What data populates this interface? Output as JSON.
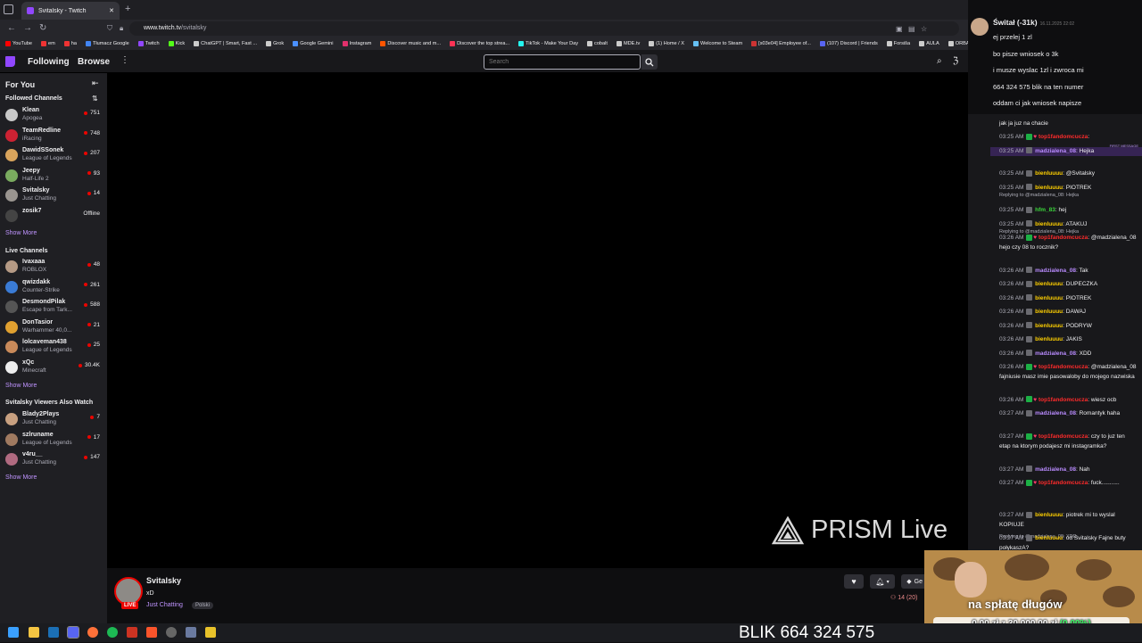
{
  "browser": {
    "tab_title": "Svitalsky - Twitch",
    "new_tab": "+",
    "url_host": "www.twitch.tv",
    "url_path": "/svitalsky",
    "bookmarks": [
      {
        "label": "YouTube",
        "color": "#ff0000"
      },
      {
        "label": "em",
        "color": "#e33"
      },
      {
        "label": "ha",
        "color": "#e33"
      },
      {
        "label": "Tłumacz Google",
        "color": "#4285f4"
      },
      {
        "label": "Twitch",
        "color": "#9147ff"
      },
      {
        "label": "Kick",
        "color": "#53fc18"
      },
      {
        "label": "ChatGPT | Smart, Fast ...",
        "color": "#cccccc"
      },
      {
        "label": "Grok",
        "color": "#cccccc"
      },
      {
        "label": "Google Gemini",
        "color": "#4b90ff"
      },
      {
        "label": "Instagram",
        "color": "#e1306c"
      },
      {
        "label": "Discover music and m...",
        "color": "#ff5500"
      },
      {
        "label": "Discover the top strea...",
        "color": "#f35"
      },
      {
        "label": "TikTok - Make Your Day",
        "color": "#25f4ee"
      },
      {
        "label": "cobalt",
        "color": "#cccccc"
      },
      {
        "label": "MDE.tv",
        "color": "#cccccc"
      },
      {
        "label": "(1) Home / X",
        "color": "#cccccc"
      },
      {
        "label": "Welcome to Steam",
        "color": "#66c0f4"
      },
      {
        "label": "[s03e04] Employee of...",
        "color": "#cc3333"
      },
      {
        "label": "(107) Discord | Friends",
        "color": "#5865f2"
      },
      {
        "label": "Forsiša",
        "color": "#cccccc"
      },
      {
        "label": "AULA",
        "color": "#cccccc"
      },
      {
        "label": "ORBAT",
        "color": "#cccccc"
      }
    ]
  },
  "nav": {
    "following": "Following",
    "browse": "Browse",
    "more": "⋮",
    "search_placeholder": "Search"
  },
  "sidebar": {
    "for_you": "For You",
    "followed_title": "Followed Channels",
    "followed": [
      {
        "name": "Klean",
        "game": "Apogea",
        "viewers": "751",
        "color": "#c8c8c8"
      },
      {
        "name": "TeamRedline",
        "game": "iRacing",
        "viewers": "748",
        "color": "#cc2233"
      },
      {
        "name": "DawidSSonek",
        "game": "League of Legends",
        "viewers": "207",
        "color": "#d9a45c"
      },
      {
        "name": "Jeepy",
        "game": "Half-Life 2",
        "viewers": "93",
        "color": "#7aab5f"
      },
      {
        "name": "Svitalsky",
        "game": "Just Chatting",
        "viewers": "14",
        "color": "#9a9590"
      },
      {
        "name": "zosik7",
        "game": "",
        "viewers": "Offline",
        "color": "#444"
      }
    ],
    "show_more_1": "Show More",
    "live_title": "Live Channels",
    "live": [
      {
        "name": "Ivaxaaa",
        "game": "ROBLOX",
        "viewers": "48",
        "color": "#b59a85"
      },
      {
        "name": "qwizdakk",
        "game": "Counter-Strike",
        "viewers": "261",
        "color": "#3a7bd5"
      },
      {
        "name": "DesmondPilak",
        "game": "Escape from Tark...",
        "viewers": "588",
        "color": "#555"
      },
      {
        "name": "DonTasior",
        "game": "Warhammer 40,0...",
        "viewers": "21",
        "color": "#e0a030"
      },
      {
        "name": "lolcaveman438",
        "game": "League of Legends",
        "viewers": "25",
        "color": "#c98a5a"
      },
      {
        "name": "xQc",
        "game": "Minecraft",
        "viewers": "30.4K",
        "color": "#eee"
      }
    ],
    "show_more_2": "Show More",
    "also_title": "Svitalsky Viewers Also Watch",
    "also": [
      {
        "name": "Blady2Plays",
        "game": "Just Chatting",
        "viewers": "7",
        "color": "#c8a080"
      },
      {
        "name": "szlruname",
        "game": "League of Legends",
        "viewers": "17",
        "color": "#a07a60"
      },
      {
        "name": "v4ru__",
        "game": "Just Chatting",
        "viewers": "147",
        "color": "#b06a80"
      }
    ],
    "show_more_3": "Show More"
  },
  "video": {
    "watermark": "PRISM Live"
  },
  "channel": {
    "name": "Svitalsky",
    "title": "xD",
    "category": "Just Chatting",
    "tag": "Polski",
    "live": "LIVE",
    "viewers": "14 (20)",
    "gift_label": "Ge"
  },
  "overlay": {
    "name": "Świtał (-31k)",
    "time": "16.11.2025 22:02",
    "lines": [
      "ej przelej 1 zl",
      "bo pisze wniosek o 3k",
      "i musze wyslac 1zl i zwroca mi",
      "664 324 575 blik na ten numer",
      "oddam ci jak wniosek napisze"
    ]
  },
  "chat": {
    "partial": "jak ja juz na chacie",
    "messages": [
      {
        "time": "03:25 AM",
        "user": "top1fandomcucza",
        "text": "",
        "color": "#ff2b2b",
        "emote": true
      },
      {
        "time": "03:25 AM",
        "user": "madzialena_08",
        "text": "Hejka",
        "color": "#b98bff",
        "first": "FIRST MESSAGE"
      },
      {
        "reply": "Replying to @madzialena_08: Hejka"
      },
      {
        "time": "03:25 AM",
        "user": "bienluuuu",
        "text": "@Svitalsky",
        "color": "#ffd000"
      },
      {
        "time": "03:25 AM",
        "user": "bienluuuu",
        "text": "PIOTREK",
        "color": "#ffd000"
      },
      {
        "reply": "Replying to @madzialena_08: Hejka"
      },
      {
        "time": "03:25 AM",
        "user": "hfm_83",
        "text": "hej",
        "color": "#3bd63b"
      },
      {
        "time": "03:25 AM",
        "user": "bienluuuu",
        "text": "ATAKUJ",
        "color": "#ffd000"
      },
      {
        "time": "03:26 AM",
        "user": "top1fandomcucza",
        "text": "@madzialena_08 hejo czy 08 to rocznik?",
        "color": "#ff2b2b"
      },
      {
        "time": "03:26 AM",
        "user": "madzialena_08",
        "text": "Tak",
        "color": "#b98bff"
      },
      {
        "time": "03:26 AM",
        "user": "bienluuuu",
        "text": "DUPECZKA",
        "color": "#ffd000"
      },
      {
        "time": "03:26 AM",
        "user": "bienluuuu",
        "text": "PIOTREK",
        "color": "#ffd000"
      },
      {
        "time": "03:26 AM",
        "user": "bienluuuu",
        "text": "DAWAJ",
        "color": "#ffd000"
      },
      {
        "time": "03:26 AM",
        "user": "bienluuuu",
        "text": "PODRYW",
        "color": "#ffd000"
      },
      {
        "time": "03:26 AM",
        "user": "bienluuuu",
        "text": "JAKIS",
        "color": "#ffd000"
      },
      {
        "time": "03:26 AM",
        "user": "madzialena_08",
        "text": "XDD",
        "color": "#b98bff"
      },
      {
        "time": "03:26 AM",
        "user": "top1fandomcucza",
        "text": "@madzialena_08 fajniusie masz imie pasowaloby do mojego nazwiska",
        "color": "#ff2b2b"
      },
      {
        "time": "03:26 AM",
        "user": "top1fandomcucza",
        "text": "wiesz ocb",
        "color": "#ff2b2b"
      },
      {
        "time": "03:27 AM",
        "user": "madzialena_08",
        "text": "Romantyk haha",
        "color": "#b98bff"
      },
      {
        "time": "03:27 AM",
        "user": "top1fandomcucza",
        "text": "czy to juz ten etap na ktorym podajesz mi instagramka?",
        "color": "#ff2b2b"
      },
      {
        "time": "03:27 AM",
        "user": "madzialena_08",
        "text": "Nah",
        "color": "#b98bff"
      },
      {
        "time": "03:27 AM",
        "user": "top1fandomcucza",
        "text": "fuck...........",
        "color": "#ff2b2b"
      },
      {
        "reply": "Replying to @madzialena_08: XDD"
      },
      {
        "time": "03:27 AM",
        "user": "bienluuuu",
        "text": "piotrek mi to wyslal KOPIUJE",
        "color": "#ffd000"
      },
      {
        "time": "03:27 AM",
        "user": "bienluuuu",
        "text": "od Svitalsky Fajne buty połykaszA?",
        "color": "#ffd000"
      }
    ]
  },
  "cam": {
    "label": "na spłatę długów",
    "progress_text": "0,00 zł",
    "of": "z",
    "goal": "30 000,00 zł",
    "percent": "(0.00%)",
    "progress_fraction": 0.0
  },
  "taskbar": {
    "blik": "BLIK 664 324 575"
  }
}
